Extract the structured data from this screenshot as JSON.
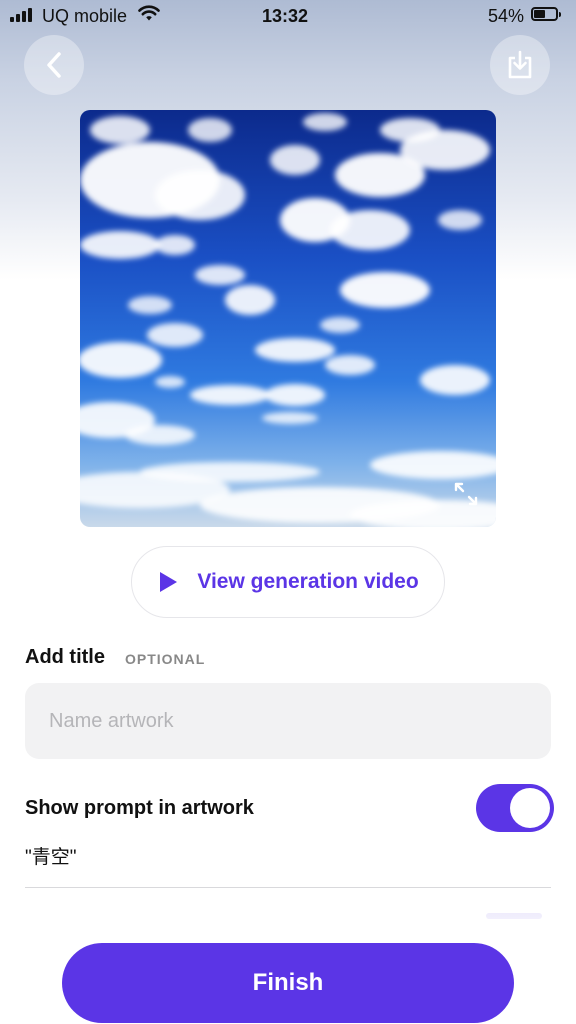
{
  "status_bar": {
    "carrier": "UQ mobile",
    "time": "13:32",
    "battery_percent_label": "54%",
    "battery_level": 0.54
  },
  "header": {
    "back_icon": "chevron-left-icon",
    "download_icon": "download-tray-icon"
  },
  "artwork": {
    "description_icon": "expand-icon"
  },
  "video_button": {
    "label": "View generation video",
    "icon": "play-icon"
  },
  "title_section": {
    "label": "Add title",
    "optional_badge": "OPTIONAL",
    "input_placeholder": "Name artwork",
    "input_value": ""
  },
  "prompt_section": {
    "label": "Show prompt in artwork",
    "toggle_on": true,
    "prompt_text": "\"青空\""
  },
  "finish_button": {
    "label": "Finish"
  },
  "colors": {
    "accent": "#5b35e6",
    "input_bg": "#f2f2f3"
  }
}
